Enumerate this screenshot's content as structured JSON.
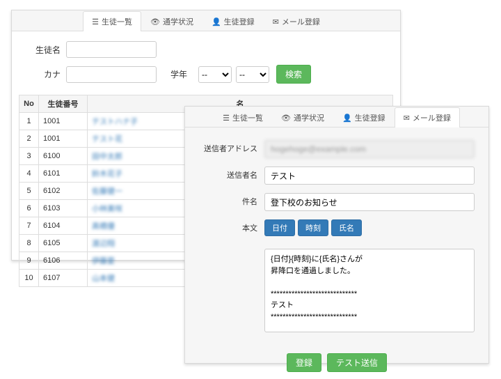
{
  "back": {
    "tabs": [
      {
        "label": "生徒一覧"
      },
      {
        "label": "通学状況"
      },
      {
        "label": "生徒登録"
      },
      {
        "label": "メール登録"
      }
    ],
    "form": {
      "name_label": "生徒名",
      "kana_label": "カナ",
      "grade_label": "学年",
      "search_btn": "検索",
      "sel1": "--",
      "sel2": "--"
    },
    "table": {
      "headers": {
        "no": "No",
        "id": "生徒番号",
        "name": "名"
      },
      "rows": [
        {
          "no": "1",
          "id": "1001",
          "name": "テストハナ子"
        },
        {
          "no": "2",
          "id": "1001",
          "name": "テスト花"
        },
        {
          "no": "3",
          "id": "6100",
          "name": "田中太郎"
        },
        {
          "no": "4",
          "id": "6101",
          "name": "鈴木花子"
        },
        {
          "no": "5",
          "id": "6102",
          "name": "佐藤健一"
        },
        {
          "no": "6",
          "id": "6103",
          "name": "小林美咲"
        },
        {
          "no": "7",
          "id": "6104",
          "name": "高橋優"
        },
        {
          "no": "8",
          "id": "6105",
          "name": "渡辺翔"
        },
        {
          "no": "9",
          "id": "6106",
          "name": "伊藤愛"
        },
        {
          "no": "10",
          "id": "6107",
          "name": "山本健"
        }
      ]
    }
  },
  "front": {
    "tabs": [
      {
        "label": "生徒一覧"
      },
      {
        "label": "通学状況"
      },
      {
        "label": "生徒登録"
      },
      {
        "label": "メール登録"
      }
    ],
    "form": {
      "addr_label": "送信者アドレス",
      "addr_value": "hogehoge@example.com",
      "sender_label": "送信者名",
      "sender_value": "テスト",
      "subject_label": "件名",
      "subject_value": "登下校のお知らせ",
      "body_label": "本文",
      "insert_date": "日付",
      "insert_time": "時刻",
      "insert_name": "氏名",
      "body_value": "{日付}{時刻}に{氏名}さんが\n昇降口を通過しました。\n\n*****************************\nテスト\n*****************************"
    },
    "footer": {
      "save": "登録",
      "test": "テスト送信"
    }
  }
}
